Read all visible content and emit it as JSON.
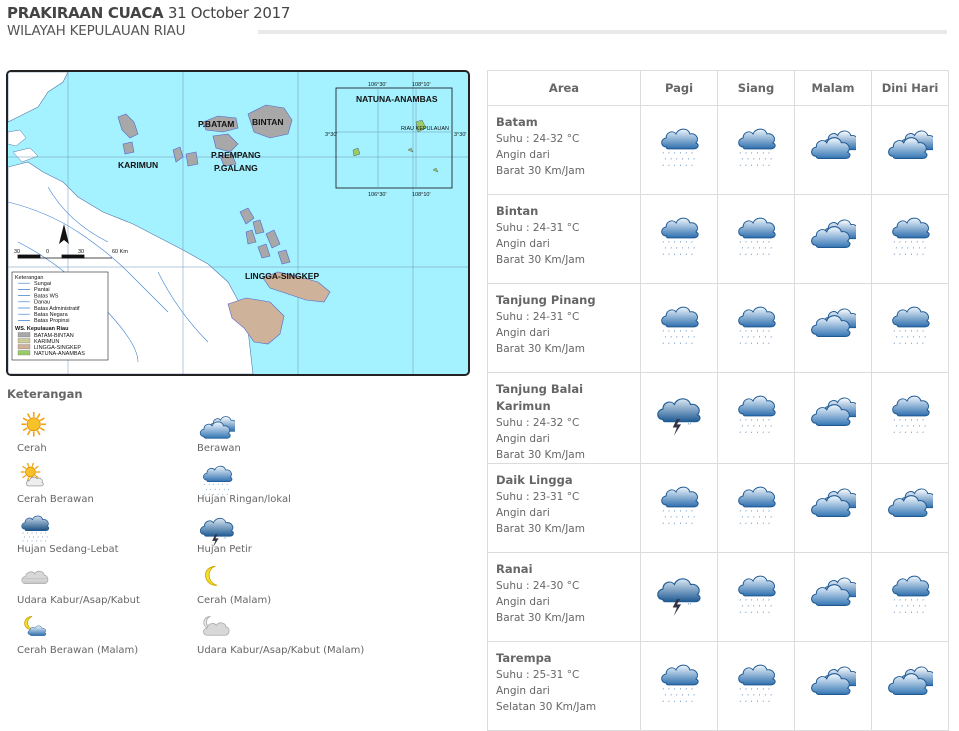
{
  "header": {
    "title_bold": "PRAKIRAAN CUACA",
    "date": "31 October 2017",
    "subtitle": "WILAYAH KEPULAUAN RIAU"
  },
  "map": {
    "labels": {
      "karimun": "KARIMUN",
      "batam": "P.BATAM",
      "bintan": "BINTAN",
      "rempang": "P.REMPANG",
      "galang": "P.GALANG",
      "lingga": "LINGGA-SINGKEP",
      "natuna": "NATUNA-ANAMBAS",
      "inset_coord_1": "106°30'",
      "inset_coord_2": "108°10'",
      "inset_coord_3": "3°30'",
      "inset_coord_4": "3°30'",
      "inset_coord_5": "106°30'",
      "inset_coord_6": "108°10'",
      "inset_small": "RIAU KEPULAUAN",
      "scale_0": "30",
      "scale_1": "0",
      "scale_2": "30",
      "scale_3": "60 Km"
    },
    "map_legend": {
      "title": "Keterangan",
      "items": [
        "Sungai",
        "Pantai",
        "Batas WS",
        "Danau",
        "Batas Administratif",
        "Batas Negara",
        "Batas Propinsi"
      ],
      "subtitle": "WS. Kepulauan Riau",
      "regions": [
        "BATAM-BINTAN",
        "KARIMUN",
        "LINGGA-SINGKEP",
        "NATUNA-ANAMBAS"
      ]
    }
  },
  "legend": {
    "title": "Keterangan",
    "items": [
      {
        "label": "Cerah",
        "icon": "sun-icon"
      },
      {
        "label": "Berawan",
        "icon": "cloud-icon"
      },
      {
        "label": "Cerah Berawan",
        "icon": "sun-cloud-icon"
      },
      {
        "label": "Hujan Ringan/lokal",
        "icon": "light-rain-icon"
      },
      {
        "label": "Hujan Sedang-Lebat",
        "icon": "heavy-rain-icon"
      },
      {
        "label": "Hujan Petir",
        "icon": "thunderstorm-icon"
      },
      {
        "label": "Udara Kabur/Asap/Kabut",
        "icon": "haze-icon"
      },
      {
        "label": "Cerah (Malam)",
        "icon": "moon-icon"
      },
      {
        "label": "Cerah Berawan (Malam)",
        "icon": "moon-cloud-icon"
      },
      {
        "label": "Udara Kabur/Asap/Kabut (Malam)",
        "icon": "night-haze-icon"
      }
    ]
  },
  "table": {
    "headers": [
      "Area",
      "Pagi",
      "Siang",
      "Malam",
      "Dini Hari"
    ],
    "rows": [
      {
        "area": "Batam",
        "suhu": "Suhu : 24-32 °C",
        "angin": "Angin dari",
        "arah": "Barat 30 Km/Jam",
        "icons": [
          "light-rain-icon",
          "light-rain-icon",
          "cloud-icon",
          "cloud-icon"
        ]
      },
      {
        "area": "Bintan",
        "suhu": "Suhu : 24-31 °C",
        "angin": "Angin dari",
        "arah": "Barat 30 Km/Jam",
        "icons": [
          "light-rain-icon",
          "light-rain-icon",
          "cloud-icon",
          "light-rain-icon"
        ]
      },
      {
        "area": "Tanjung Pinang",
        "suhu": "Suhu : 24-31 °C",
        "angin": "Angin dari",
        "arah": "Barat 30 Km/Jam",
        "icons": [
          "light-rain-icon",
          "light-rain-icon",
          "cloud-icon",
          "light-rain-icon"
        ]
      },
      {
        "area": "Tanjung Balai Karimun",
        "suhu": "Suhu : 24-32 °C",
        "angin": "Angin dari",
        "arah": "Barat 30 Km/Jam",
        "icons": [
          "thunderstorm-icon",
          "light-rain-icon",
          "cloud-icon",
          "light-rain-icon"
        ]
      },
      {
        "area": "Daik Lingga",
        "suhu": "Suhu : 23-31 °C",
        "angin": "Angin dari",
        "arah": "Barat 30 Km/Jam",
        "icons": [
          "light-rain-icon",
          "light-rain-icon",
          "cloud-icon",
          "cloud-icon"
        ]
      },
      {
        "area": "Ranai",
        "suhu": "Suhu : 24-30 °C",
        "angin": "Angin dari",
        "arah": "Barat 30 Km/Jam",
        "icons": [
          "thunderstorm-icon",
          "light-rain-icon",
          "cloud-icon",
          "light-rain-icon"
        ]
      },
      {
        "area": "Tarempa",
        "suhu": "Suhu : 25-31 °C",
        "angin": "Angin dari",
        "arah": "Selatan 30 Km/Jam",
        "icons": [
          "light-rain-icon",
          "light-rain-icon",
          "cloud-icon",
          "cloud-icon"
        ]
      }
    ]
  },
  "colors": {
    "sea": "#a4f1ff",
    "land_gray": "#a8a8a8",
    "land_tan": "#cfb29a",
    "cloud_dark": "#2f6fae",
    "cloud_light": "#e9f4fb",
    "border": "#dcdcdc",
    "text": "#666666"
  }
}
